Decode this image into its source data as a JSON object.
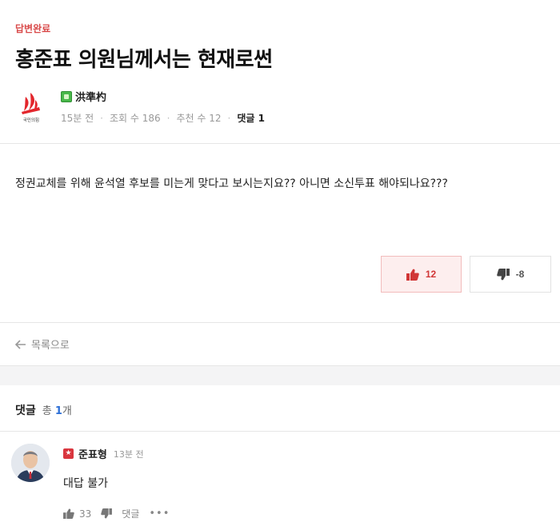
{
  "post": {
    "status": "답변완료",
    "title": "홍준표 의원님께서는 현재로썬",
    "author": {
      "name": "洪準杓",
      "grade_icon": "level-badge-icon",
      "logo_text": "국민의힘"
    },
    "meta": {
      "time": "15분 전",
      "views": "조회 수 186",
      "recommends": "추천 수 12",
      "comments": "댓글 1"
    },
    "body": "정권교체를 위해 윤석열 후보를 미는게 맞다고 보시는지요?? 아니면 소신투표 해야되나요???",
    "votes": {
      "up": "12",
      "down": "-8"
    }
  },
  "nav": {
    "back_label": "목록으로"
  },
  "comments": {
    "heading": "댓글",
    "total_prefix": "총",
    "total_count": "1",
    "total_suffix": "개",
    "items": [
      {
        "author": "준표형",
        "time": "13분 전",
        "text": "대답 불가",
        "likes": "33",
        "reply_label": "댓글",
        "more": "•••"
      }
    ]
  },
  "colors": {
    "accent_red": "#d94a4a",
    "link_blue": "#2d6fd6",
    "upvote_bg": "#fdeeee",
    "grade_green": "#49b84a"
  }
}
